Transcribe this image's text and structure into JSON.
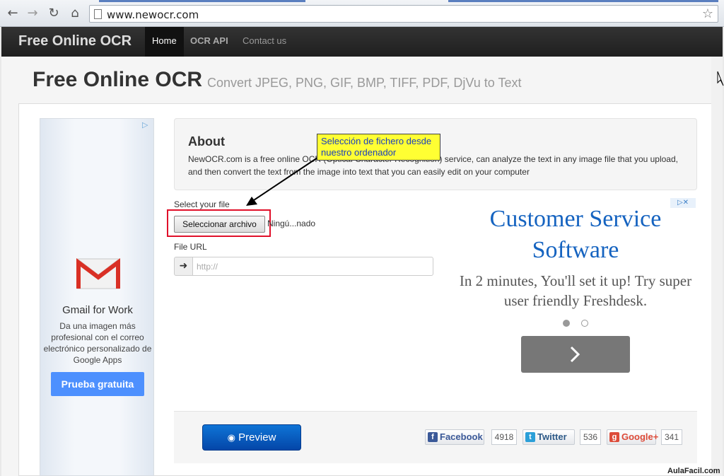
{
  "browser": {
    "url": "www.newocr.com",
    "back_icon": "back-arrow-icon",
    "forward_icon": "forward-arrow-icon",
    "reload_icon": "reload-icon",
    "home_icon": "home-icon",
    "bookmark_icon": "star-icon"
  },
  "navbar": {
    "brand": "Free Online OCR",
    "items": [
      {
        "label": "Home",
        "active": true
      },
      {
        "label": "OCR API",
        "active": false
      },
      {
        "label": "Contact us",
        "active": false
      }
    ]
  },
  "header": {
    "title": "Free Online OCR",
    "subtitle": "Convert JPEG, PNG, GIF, BMP, TIFF, PDF, DjVu to Text"
  },
  "left_ad": {
    "title": "Gmail for Work",
    "text": "Da una imagen más profesional con el correo electrónico personalizado de Google Apps",
    "button": "Prueba gratuita",
    "adchoices": "▷"
  },
  "about": {
    "heading": "About",
    "text": "NewOCR.com is a free online OCR (Optical Character Recognition) service, can analyze the text in any image file that you upload, and then convert the text from the image into text that you can easily edit on your computer"
  },
  "callout": {
    "text": "Selección de fichero desde nuestro ordenador"
  },
  "form": {
    "select_label": "Select your file",
    "choose_button": "Seleccionar archivo",
    "no_file_text": "Ningú...nado",
    "url_label": "File URL",
    "url_addon": "➜",
    "url_placeholder": "http://"
  },
  "right_ad": {
    "adchoices": "▷✕",
    "headline": "Customer Service Software",
    "body": "In 2 minutes, You'll set it up! Try super user friendly Freshdesk.",
    "arrow": "›"
  },
  "footer": {
    "preview_button": "Preview",
    "share": [
      {
        "name": "Facebook",
        "count": "4918",
        "color": "#3b5998",
        "icon": "f"
      },
      {
        "name": "Twitter",
        "count": "536",
        "color": "#2b9fd8",
        "icon": "t"
      },
      {
        "name": "Google+",
        "count": "341",
        "color": "#dd4b39",
        "icon": "g"
      }
    ]
  },
  "watermark": "AulaFacil.com"
}
